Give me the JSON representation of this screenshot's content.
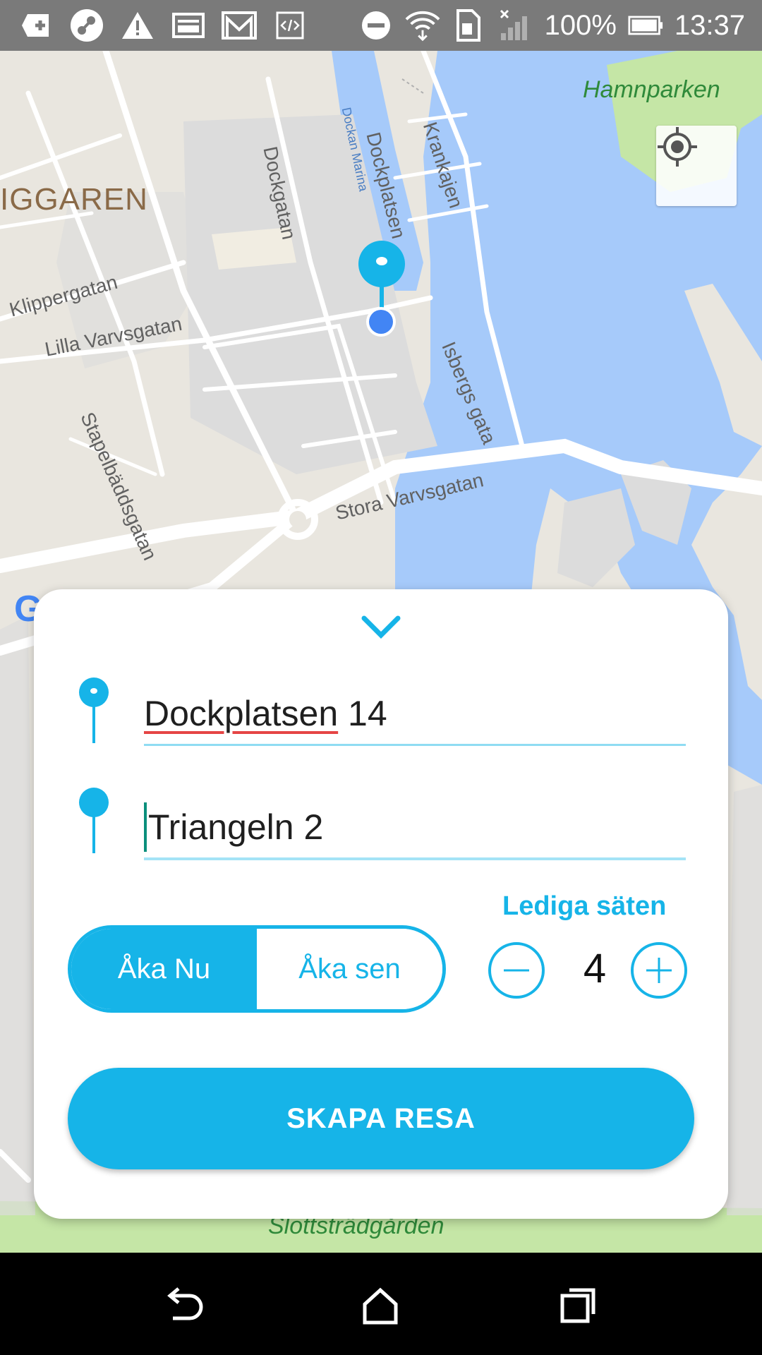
{
  "status_bar": {
    "battery": "100%",
    "time": "13:37"
  },
  "map": {
    "district": "IGGAREN",
    "park_top": "Hamnparken",
    "park_bottom": "Slottsträdgården",
    "water_label": "Dockan Marina",
    "streets": {
      "dockgatan": "Dockgatan",
      "dockplatsen": "Dockplatsen",
      "krankajen": "Krankajen",
      "klippergatan": "Klippergatan",
      "lilla_varvsgatan": "Lilla Varvsgatan",
      "isbergs_gata": "Isbergs gata",
      "stapelbaddsgatan": "Stapelbäddsgatan",
      "stora_varvsgatan": "Stora Varvsgatan"
    },
    "attribution": "Google",
    "colors": {
      "land": "#e9e6df",
      "water": "#a6cafa",
      "park": "#c5e6a6",
      "road": "#ffffff",
      "block": "#dcdcdc"
    }
  },
  "trip_form": {
    "from_value": "Dockplatsen 14",
    "from_underlined": "Dockplatsen",
    "from_rest": " 14",
    "to_value": "Triangeln 2",
    "seats_label": "Lediga säten",
    "seat_count": "4",
    "toggle": {
      "now_label": "Åka Nu",
      "later_label": "Åka sen",
      "selected": "now"
    },
    "submit_label": "SKAPA RESA",
    "accent_color": "#16b4e8"
  },
  "icons": {
    "status_left": [
      "plus-box-icon",
      "app-bubble-icon",
      "warning-icon",
      "image-icon",
      "gmail-icon",
      "code-icon"
    ],
    "status_right": [
      "do-not-disturb-icon",
      "wifi-icon",
      "sim-icon",
      "signal-off-icon",
      "battery-icon"
    ],
    "nav": [
      "back-icon",
      "home-icon",
      "recents-icon"
    ]
  }
}
